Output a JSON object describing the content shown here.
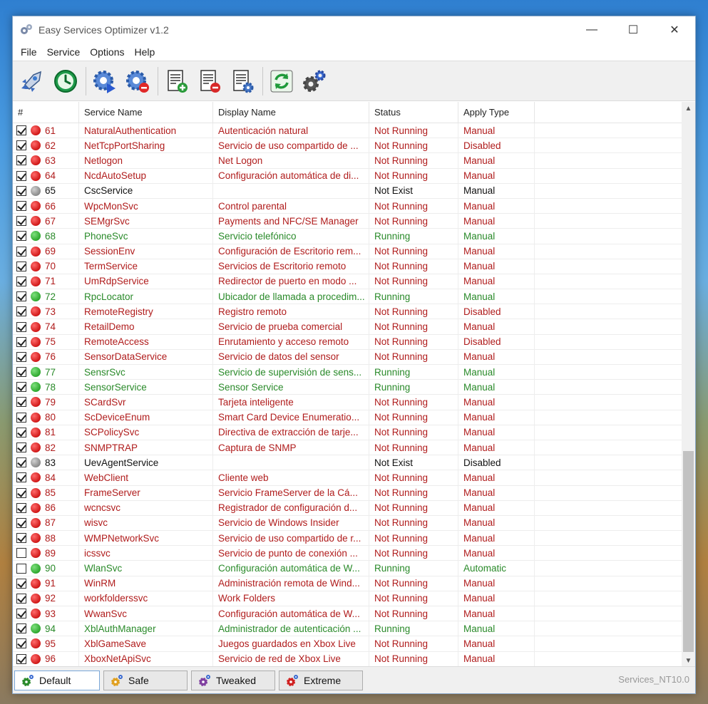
{
  "window": {
    "title": "Easy Services Optimizer v1.2",
    "minimize": "—",
    "maximize": "☐",
    "close": "✕"
  },
  "menu": [
    "File",
    "Service",
    "Options",
    "Help"
  ],
  "toolbar": {
    "icons": [
      "rocket-icon",
      "clock-icon",
      "gear-run-icon",
      "gear-stop-icon",
      "doc-add-icon",
      "doc-remove-icon",
      "doc-settings-icon",
      "refresh-icon",
      "gears-icon"
    ]
  },
  "table": {
    "headers": [
      "#",
      "Service Name",
      "Display Name",
      "Status",
      "Apply Type"
    ],
    "rows": [
      {
        "checked": true,
        "state": "red",
        "num": "61",
        "name": "NaturalAuthentication",
        "display": "Autenticación natural",
        "status": "Not Running",
        "apply": "Manual"
      },
      {
        "checked": true,
        "state": "red",
        "num": "62",
        "name": "NetTcpPortSharing",
        "display": "Servicio de uso compartido de ...",
        "status": "Not Running",
        "apply": "Disabled"
      },
      {
        "checked": true,
        "state": "red",
        "num": "63",
        "name": "Netlogon",
        "display": "Net Logon",
        "status": "Not Running",
        "apply": "Manual"
      },
      {
        "checked": true,
        "state": "red",
        "num": "64",
        "name": "NcdAutoSetup",
        "display": "Configuración automática de di...",
        "status": "Not Running",
        "apply": "Manual"
      },
      {
        "checked": true,
        "state": "gray",
        "num": "65",
        "name": "CscService",
        "display": "",
        "status": "Not Exist",
        "apply": "Manual"
      },
      {
        "checked": true,
        "state": "red",
        "num": "66",
        "name": "WpcMonSvc",
        "display": "Control parental",
        "status": "Not Running",
        "apply": "Manual"
      },
      {
        "checked": true,
        "state": "red",
        "num": "67",
        "name": "SEMgrSvc",
        "display": "Payments and NFC/SE Manager",
        "status": "Not Running",
        "apply": "Manual"
      },
      {
        "checked": true,
        "state": "green",
        "num": "68",
        "name": "PhoneSvc",
        "display": "Servicio telefónico",
        "status": "Running",
        "apply": "Manual"
      },
      {
        "checked": true,
        "state": "red",
        "num": "69",
        "name": "SessionEnv",
        "display": "Configuración de Escritorio rem...",
        "status": "Not Running",
        "apply": "Manual"
      },
      {
        "checked": true,
        "state": "red",
        "num": "70",
        "name": "TermService",
        "display": "Servicios de Escritorio remoto",
        "status": "Not Running",
        "apply": "Manual"
      },
      {
        "checked": true,
        "state": "red",
        "num": "71",
        "name": "UmRdpService",
        "display": "Redirector de puerto en modo ...",
        "status": "Not Running",
        "apply": "Manual"
      },
      {
        "checked": true,
        "state": "green",
        "num": "72",
        "name": "RpcLocator",
        "display": "Ubicador de llamada a procedim...",
        "status": "Running",
        "apply": "Manual"
      },
      {
        "checked": true,
        "state": "red",
        "num": "73",
        "name": "RemoteRegistry",
        "display": "Registro remoto",
        "status": "Not Running",
        "apply": "Disabled"
      },
      {
        "checked": true,
        "state": "red",
        "num": "74",
        "name": "RetailDemo",
        "display": "Servicio de prueba comercial",
        "status": "Not Running",
        "apply": "Manual"
      },
      {
        "checked": true,
        "state": "red",
        "num": "75",
        "name": "RemoteAccess",
        "display": "Enrutamiento y acceso remoto",
        "status": "Not Running",
        "apply": "Disabled"
      },
      {
        "checked": true,
        "state": "red",
        "num": "76",
        "name": "SensorDataService",
        "display": "Servicio de datos del sensor",
        "status": "Not Running",
        "apply": "Manual"
      },
      {
        "checked": true,
        "state": "green",
        "num": "77",
        "name": "SensrSvc",
        "display": "Servicio de supervisión de sens...",
        "status": "Running",
        "apply": "Manual"
      },
      {
        "checked": true,
        "state": "green",
        "num": "78",
        "name": "SensorService",
        "display": "Sensor Service",
        "status": "Running",
        "apply": "Manual"
      },
      {
        "checked": true,
        "state": "red",
        "num": "79",
        "name": "SCardSvr",
        "display": "Tarjeta inteligente",
        "status": "Not Running",
        "apply": "Manual"
      },
      {
        "checked": true,
        "state": "red",
        "num": "80",
        "name": "ScDeviceEnum",
        "display": "Smart Card Device Enumeratio...",
        "status": "Not Running",
        "apply": "Manual"
      },
      {
        "checked": true,
        "state": "red",
        "num": "81",
        "name": "SCPolicySvc",
        "display": "Directiva de extracción de tarje...",
        "status": "Not Running",
        "apply": "Manual"
      },
      {
        "checked": true,
        "state": "red",
        "num": "82",
        "name": "SNMPTRAP",
        "display": "Captura de SNMP",
        "status": "Not Running",
        "apply": "Manual"
      },
      {
        "checked": true,
        "state": "gray",
        "num": "83",
        "name": "UevAgentService",
        "display": "",
        "status": "Not Exist",
        "apply": "Disabled"
      },
      {
        "checked": true,
        "state": "red",
        "num": "84",
        "name": "WebClient",
        "display": "Cliente web",
        "status": "Not Running",
        "apply": "Manual"
      },
      {
        "checked": true,
        "state": "red",
        "num": "85",
        "name": "FrameServer",
        "display": "Servicio FrameServer de la Cá...",
        "status": "Not Running",
        "apply": "Manual"
      },
      {
        "checked": true,
        "state": "red",
        "num": "86",
        "name": "wcncsvc",
        "display": "Registrador de configuración d...",
        "status": "Not Running",
        "apply": "Manual"
      },
      {
        "checked": true,
        "state": "red",
        "num": "87",
        "name": "wisvc",
        "display": "Servicio de Windows Insider",
        "status": "Not Running",
        "apply": "Manual"
      },
      {
        "checked": true,
        "state": "red",
        "num": "88",
        "name": "WMPNetworkSvc",
        "display": "Servicio de uso compartido de r...",
        "status": "Not Running",
        "apply": "Manual"
      },
      {
        "checked": false,
        "state": "red",
        "num": "89",
        "name": "icssvc",
        "display": "Servicio de punto de conexión ...",
        "status": "Not Running",
        "apply": "Manual"
      },
      {
        "checked": false,
        "state": "green",
        "num": "90",
        "name": "WlanSvc",
        "display": "Configuración automática de W...",
        "status": "Running",
        "apply": "Automatic"
      },
      {
        "checked": true,
        "state": "red",
        "num": "91",
        "name": "WinRM",
        "display": "Administración remota de Wind...",
        "status": "Not Running",
        "apply": "Manual"
      },
      {
        "checked": true,
        "state": "red",
        "num": "92",
        "name": "workfolderssvc",
        "display": "Work Folders",
        "status": "Not Running",
        "apply": "Manual"
      },
      {
        "checked": true,
        "state": "red",
        "num": "93",
        "name": "WwanSvc",
        "display": "Configuración automática de W...",
        "status": "Not Running",
        "apply": "Manual"
      },
      {
        "checked": true,
        "state": "green",
        "num": "94",
        "name": "XblAuthManager",
        "display": "Administrador de autenticación ...",
        "status": "Running",
        "apply": "Manual"
      },
      {
        "checked": true,
        "state": "red",
        "num": "95",
        "name": "XblGameSave",
        "display": "Juegos guardados en Xbox Live",
        "status": "Not Running",
        "apply": "Manual"
      },
      {
        "checked": true,
        "state": "red",
        "num": "96",
        "name": "XboxNetApiSvc",
        "display": "Servicio de red de Xbox Live",
        "status": "Not Running",
        "apply": "Manual"
      }
    ]
  },
  "bottom": {
    "buttons": [
      {
        "label": "Default",
        "color": "#2a8a2a",
        "active": true
      },
      {
        "label": "Safe",
        "color": "#e0a020",
        "active": false
      },
      {
        "label": "Tweaked",
        "color": "#8040a0",
        "active": false
      },
      {
        "label": "Extreme",
        "color": "#d02020",
        "active": false
      }
    ],
    "status": "Services_NT10.0"
  },
  "colors": {
    "not_running": "#b01c1c",
    "running": "#2a8a2a",
    "not_exist": "#111111"
  }
}
